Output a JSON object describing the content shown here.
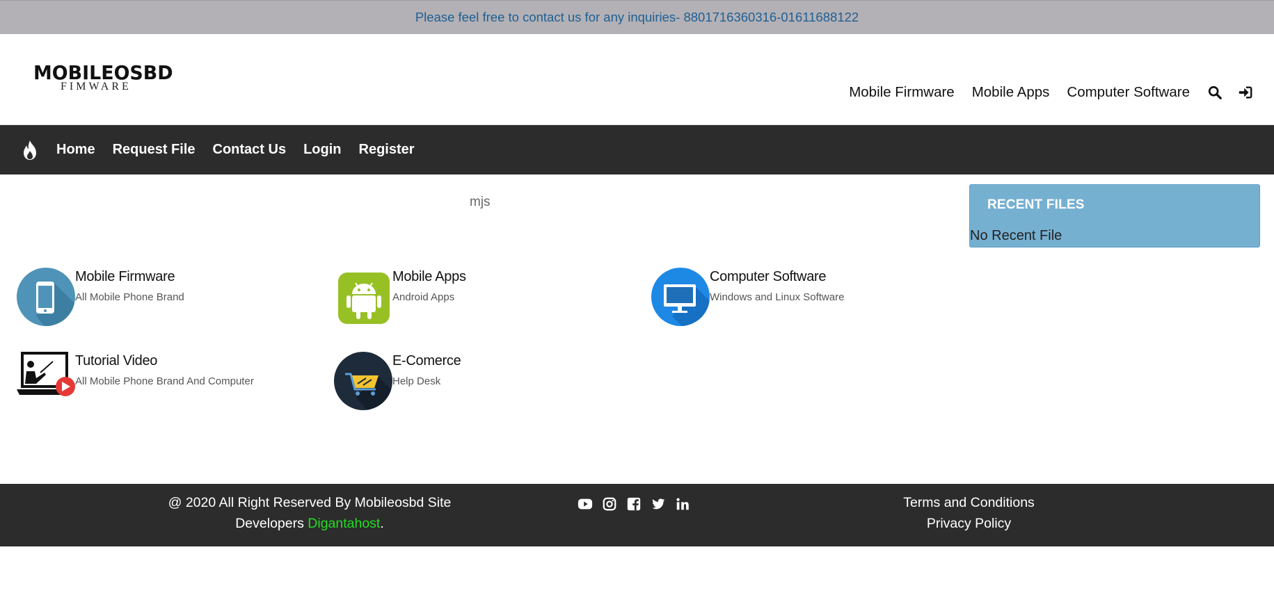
{
  "topbar": {
    "notice": "Please feel free to contact us for any inquiries- 8801716360316-01611688122"
  },
  "header": {
    "logo_line1": "MOBILEOSBD",
    "logo_line2": "FIMWARE",
    "nav": [
      {
        "label": "Mobile Firmware"
      },
      {
        "label": "Mobile Apps"
      },
      {
        "label": "Computer Software"
      }
    ],
    "icons": [
      "search-icon",
      "sign-in-icon"
    ]
  },
  "mainnav": {
    "icon": "fire-icon",
    "items": [
      {
        "label": "Home"
      },
      {
        "label": "Request File"
      },
      {
        "label": "Contact Us"
      },
      {
        "label": "Login"
      },
      {
        "label": "Register"
      }
    ]
  },
  "main": {
    "heading": "mjs",
    "categories": [
      {
        "title": "Mobile Firmware",
        "subtitle": "All Mobile Phone Brand",
        "icon": "smartphone-icon"
      },
      {
        "title": "Mobile Apps",
        "subtitle": "Android Apps",
        "icon": "android-icon"
      },
      {
        "title": "Computer Software",
        "subtitle": "Windows and Linux Software",
        "icon": "monitor-icon"
      },
      {
        "title": "Tutorial Video",
        "subtitle": "All Mobile Phone Brand And Computer",
        "icon": "tutorial-video-icon"
      },
      {
        "title": "E-Comerce",
        "subtitle": "Help Desk",
        "icon": "shopping-cart-icon"
      }
    ]
  },
  "sidebar": {
    "title": "RECENT FILES",
    "empty_text": "No Recent File"
  },
  "footer": {
    "copyright": "@ 2020 All Right Reserved By Mobileosbd Site",
    "developers_prefix": "Developers",
    "developer_name": "Digantahost",
    "developer_suffix": ".",
    "social": [
      "youtube-icon",
      "instagram-icon",
      "facebook-icon",
      "twitter-icon",
      "linkedin-icon"
    ],
    "links": [
      {
        "label": "Terms and Conditions"
      },
      {
        "label": "Privacy Policy"
      }
    ]
  },
  "colors": {
    "topbar_bg": "#b3b1b6",
    "topbar_text": "#1f5f93",
    "nav_bg": "#2c2c2c",
    "recent_bg": "#76b0d1",
    "developer_link": "#22dd22"
  }
}
